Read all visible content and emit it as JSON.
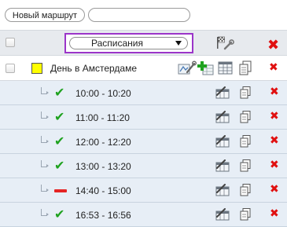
{
  "toolbar": {
    "new_route_label": "Новый маршрут",
    "search_value": ""
  },
  "header": {
    "select_value": "Расписания",
    "settings_icon": "flag-wrench-icon",
    "delete_icon": "delete-x-icon"
  },
  "group": {
    "name": "День в Амстердаме",
    "color": "#ffff00",
    "icons": [
      "edit-route-icon",
      "add-schedule-icon",
      "schedule-grid-icon",
      "copy-doc-icon",
      "delete-x-icon"
    ]
  },
  "schedules": [
    {
      "time": "10:00 - 10:20",
      "status": "active"
    },
    {
      "time": "11:00 - 11:20",
      "status": "active"
    },
    {
      "time": "12:00 - 12:20",
      "status": "active"
    },
    {
      "time": "13:00 - 13:20",
      "status": "active"
    },
    {
      "time": "14:40 - 15:00",
      "status": "disabled"
    },
    {
      "time": "16:53 - 16:56",
      "status": "active"
    }
  ],
  "colors": {
    "accent_border": "#9b35c9",
    "row_background": "#e7eef6",
    "check_green": "#1fa21f",
    "delete_red": "#e01010"
  }
}
